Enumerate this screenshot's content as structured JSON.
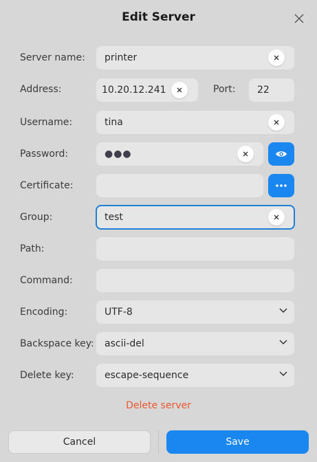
{
  "dialog": {
    "title": "Edit Server"
  },
  "fields": {
    "server_name": {
      "label": "Server name:",
      "value": "printer"
    },
    "address": {
      "label": "Address:",
      "value": "10.20.12.241"
    },
    "port": {
      "label": "Port:",
      "value": "22"
    },
    "username": {
      "label": "Username:",
      "value": "tina"
    },
    "password": {
      "label": "Password:",
      "value": "●●●"
    },
    "certificate": {
      "label": "Certificate:",
      "value": ""
    },
    "group": {
      "label": "Group:",
      "value": "test"
    },
    "path": {
      "label": "Path:",
      "value": ""
    },
    "command": {
      "label": "Command:",
      "value": ""
    },
    "encoding": {
      "label": "Encoding:",
      "value": "UTF-8"
    },
    "backspace_key": {
      "label": "Backspace key:",
      "value": "ascii-del"
    },
    "delete_key": {
      "label": "Delete key:",
      "value": "escape-sequence"
    }
  },
  "actions": {
    "delete_server": "Delete server",
    "cancel": "Cancel",
    "save": "Save"
  },
  "colors": {
    "accent": "#1a86f0",
    "danger": "#e9582f",
    "background": "#d7d7d7"
  }
}
